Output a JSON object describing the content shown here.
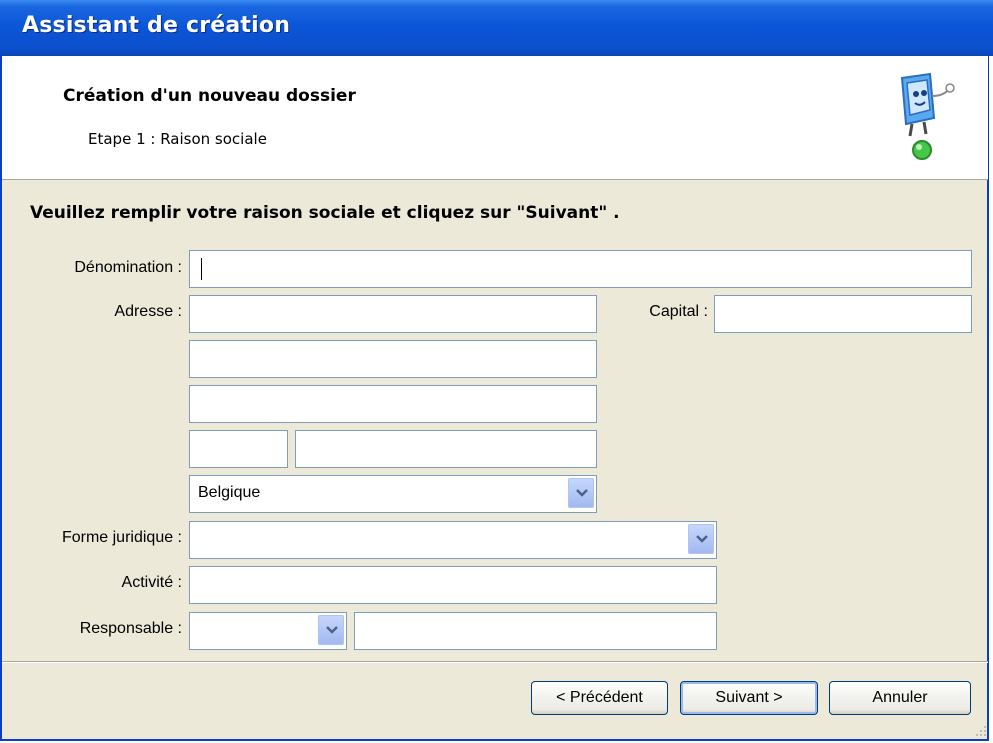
{
  "window": {
    "title": "Assistant de création"
  },
  "header": {
    "title": "Création d'un nouveau dossier",
    "subtitle": "Etape 1 : Raison sociale",
    "icon": "wizard-computer-icon"
  },
  "form": {
    "instruction": "Veuillez remplir votre raison sociale et cliquez sur \"Suivant\" .",
    "denomination": {
      "label": "Dénomination :",
      "value": ""
    },
    "adresse": {
      "label": "Adresse :",
      "line1": "",
      "line2": "",
      "line3": "",
      "postal_code": "",
      "city": "",
      "country": "Belgique"
    },
    "capital": {
      "label": "Capital :",
      "value": ""
    },
    "forme_juridique": {
      "label": "Forme juridique :",
      "value": ""
    },
    "activite": {
      "label": "Activité :",
      "value": ""
    },
    "responsable": {
      "label": "Responsable :",
      "selected": "",
      "value": ""
    }
  },
  "buttons": {
    "previous": "< Précédent",
    "next": "Suivant >",
    "cancel": "Annuler"
  },
  "colors": {
    "titlebar": "#0a55d8",
    "dialog_bg": "#ece9d8",
    "field_border": "#7f9db9",
    "button_border": "#003c74"
  }
}
